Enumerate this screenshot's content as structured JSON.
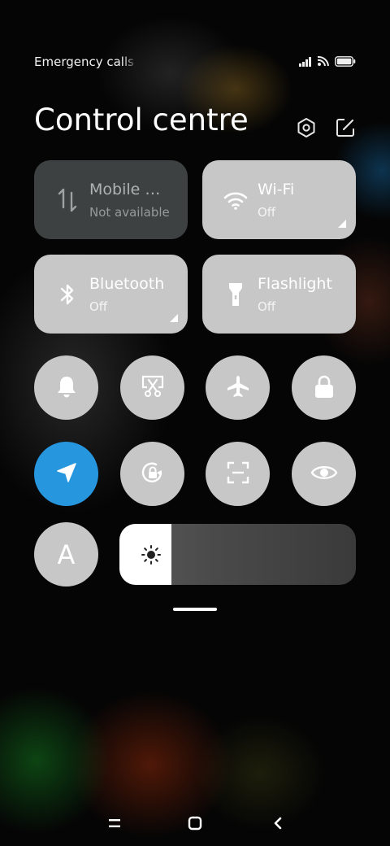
{
  "status_bar": {
    "text": "Emergency calls only",
    "icons": [
      "signal-icon",
      "wifi-calling-icon",
      "battery-icon"
    ]
  },
  "header": {
    "title": "Control centre",
    "actions": [
      "settings-icon",
      "edit-icon"
    ]
  },
  "tiles": [
    {
      "name": "mobile-data",
      "label": "Mobile data",
      "status": "Not available",
      "icon": "mobile-data-icon",
      "enabled": false
    },
    {
      "name": "wifi",
      "label": "Wi-Fi",
      "status": "Off",
      "icon": "wifi-icon",
      "enabled": true
    },
    {
      "name": "bluetooth",
      "label": "Bluetooth",
      "status": "Off",
      "icon": "bluetooth-icon",
      "enabled": true
    },
    {
      "name": "flashlight",
      "label": "Flashlight",
      "status": "Off",
      "icon": "flashlight-icon",
      "enabled": true
    }
  ],
  "toggles": [
    {
      "name": "mute",
      "icon": "bell-icon",
      "active": false
    },
    {
      "name": "screenshot",
      "icon": "screenshot-icon",
      "active": false
    },
    {
      "name": "airplane-mode",
      "icon": "airplane-icon",
      "active": false
    },
    {
      "name": "lock-screen",
      "icon": "lock-icon",
      "active": false
    },
    {
      "name": "location",
      "icon": "location-arrow-icon",
      "active": true
    },
    {
      "name": "auto-rotate",
      "icon": "rotation-lock-icon",
      "active": false
    },
    {
      "name": "scanner",
      "icon": "scan-icon",
      "active": false
    },
    {
      "name": "reading-mode",
      "icon": "eye-icon",
      "active": false
    }
  ],
  "auto_brightness": {
    "label": "A",
    "icon": "auto-brightness-icon"
  },
  "brightness": {
    "level": 0.22,
    "icon": "sun-icon"
  },
  "nav": [
    "menu-icon",
    "home-icon",
    "back-icon"
  ],
  "colors": {
    "tile": "#c7c7c7",
    "active": "#2697df",
    "background": "#050505"
  }
}
